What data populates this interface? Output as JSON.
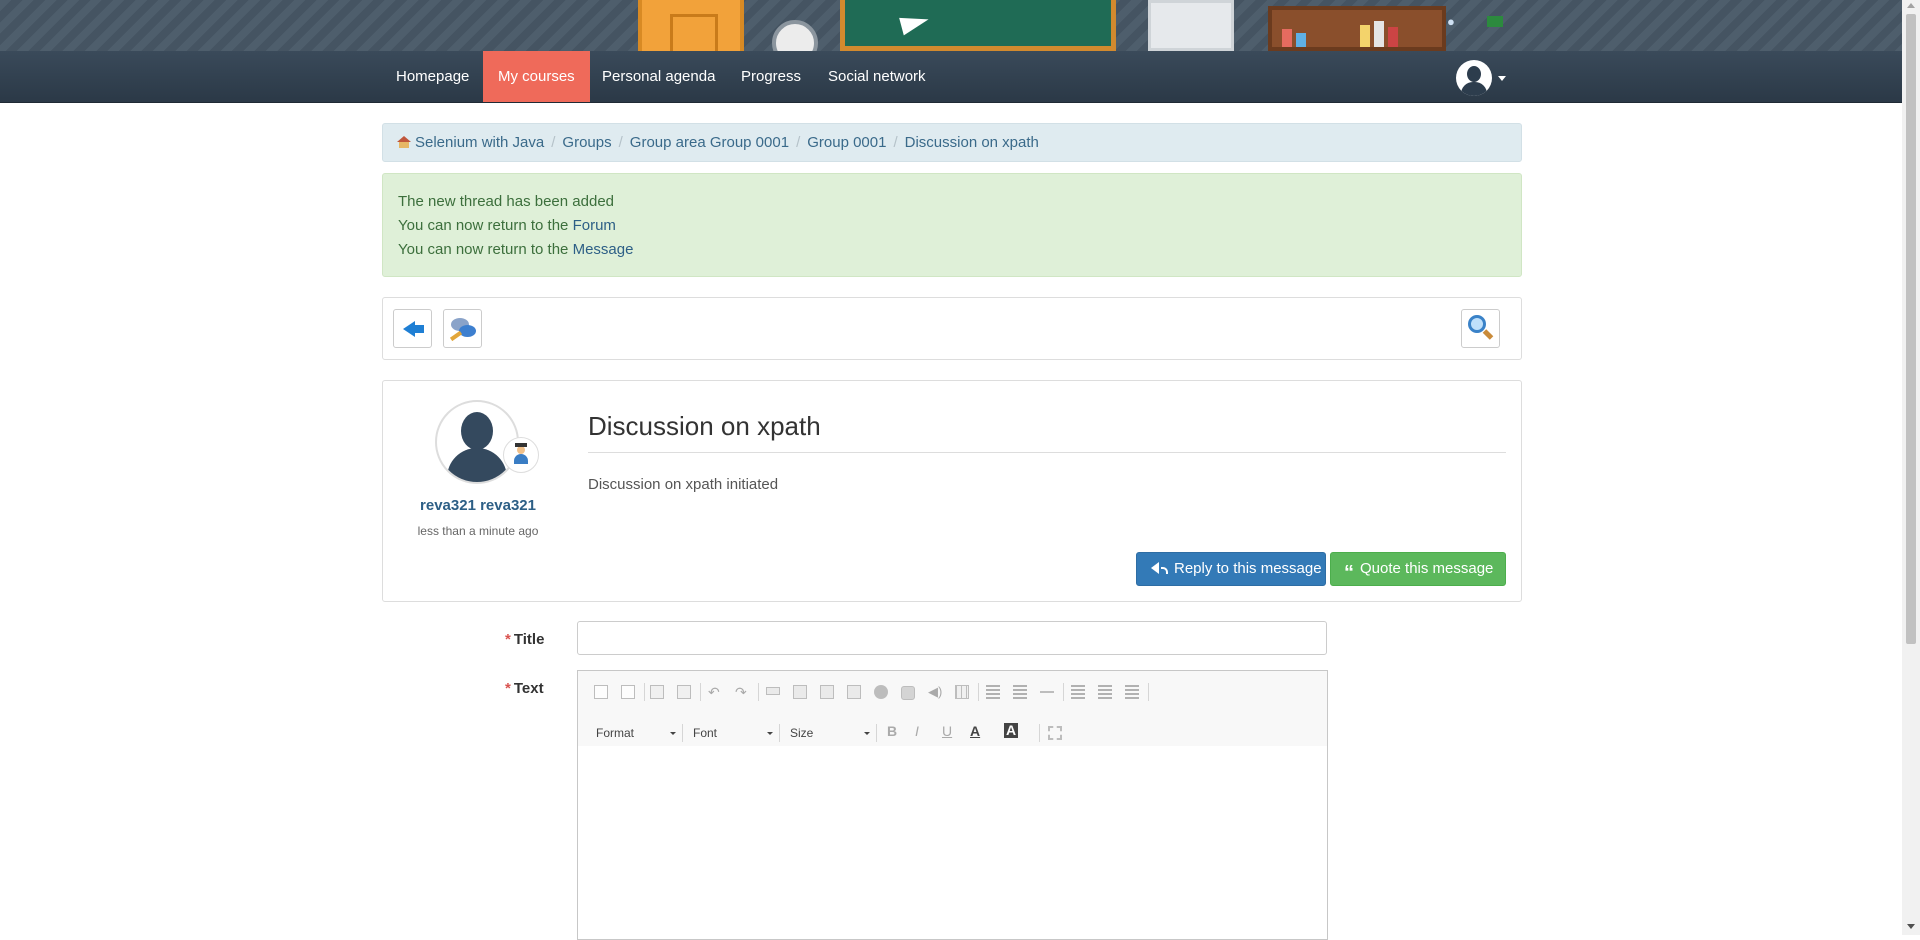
{
  "nav": {
    "items": [
      {
        "label": "Homepage"
      },
      {
        "label": "My courses",
        "active": true
      },
      {
        "label": "Personal agenda"
      },
      {
        "label": "Progress"
      },
      {
        "label": "Social network"
      }
    ],
    "user_icon": "user-avatar-icon"
  },
  "breadcrumb": {
    "items": [
      "Selenium with Java",
      "Groups",
      "Group area Group 0001",
      "Group 0001",
      "Discussion on xpath"
    ]
  },
  "alert": {
    "line1": "The new thread has been added",
    "line2_prefix": "You can now return to the ",
    "line2_link": "Forum",
    "line3_prefix": "You can now return to the ",
    "line3_link": "Message"
  },
  "toolbar": {
    "back_icon": "back-arrow-icon",
    "reply_thread_icon": "reply-thread-icon",
    "search_icon": "search-icon"
  },
  "post": {
    "author": "reva321 reva321",
    "time": "less than a minute ago",
    "title": "Discussion on xpath",
    "body": "Discussion on xpath initiated",
    "reply_label": "Reply to this message",
    "quote_label": "Quote this message"
  },
  "form": {
    "required_mark": "*",
    "title_label": "Title",
    "title_value": "",
    "text_label": "Text",
    "editor": {
      "format": "Format",
      "font": "Font",
      "size": "Size",
      "bold": "B",
      "italic": "I",
      "underline": "U",
      "text_color": "A",
      "bg_color": "A"
    }
  },
  "colors": {
    "nav_active": "#ef6a5a",
    "link": "#2d5f86",
    "alert_bg": "#dff0d8",
    "reply_button": "#337ab7",
    "quote_button": "#5cb85c"
  }
}
